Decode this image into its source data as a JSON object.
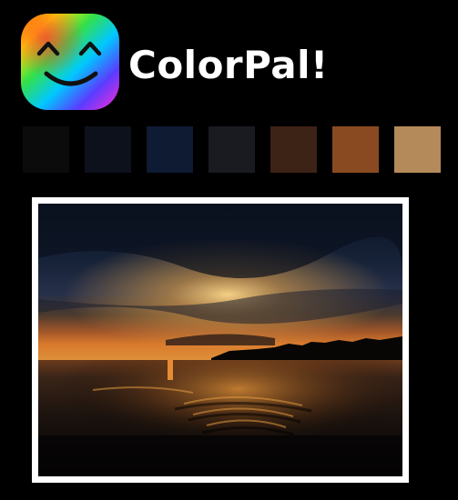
{
  "app": {
    "title": "ColorPal!",
    "logo_icon": "smiley-face-icon"
  },
  "palette": {
    "swatches": [
      {
        "name": "swatch-1",
        "color": "#0b0b0c"
      },
      {
        "name": "swatch-2",
        "color": "#0c111c"
      },
      {
        "name": "swatch-3",
        "color": "#0f1a33"
      },
      {
        "name": "swatch-4",
        "color": "#1a1b20"
      },
      {
        "name": "swatch-5",
        "color": "#3d2216"
      },
      {
        "name": "swatch-6",
        "color": "#8a4a21"
      },
      {
        "name": "swatch-7",
        "color": "#b58a5a"
      }
    ]
  },
  "image": {
    "subject": "sunset-over-lake-photo"
  }
}
